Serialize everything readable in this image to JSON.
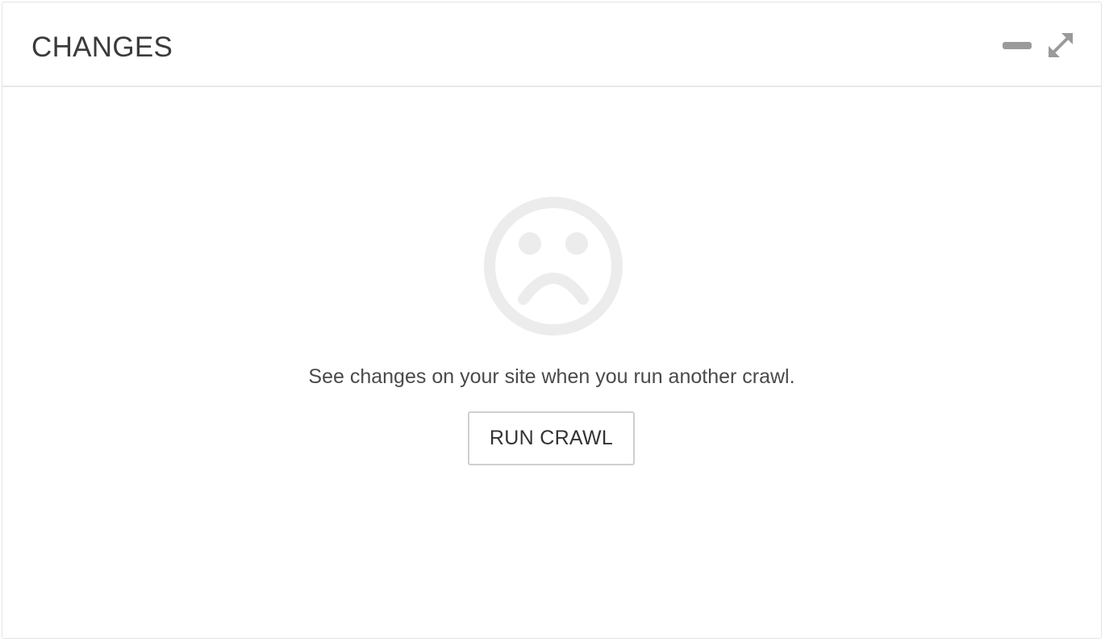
{
  "panel": {
    "title": "CHANGES",
    "controls": {
      "minimize_icon": "minus-icon",
      "expand_icon": "expand-icon"
    }
  },
  "empty_state": {
    "icon": "sad-face-icon",
    "message": "See changes on your site when you run another crawl.",
    "action_label": "RUN CRAWL"
  },
  "colors": {
    "icon_gray": "#9a9a9a",
    "face_gray": "#ececec",
    "text": "#4a4a4a",
    "border": "#cfcfcf"
  }
}
